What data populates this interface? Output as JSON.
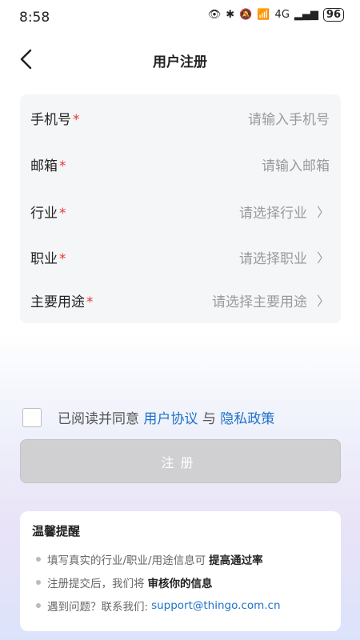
{
  "status": {
    "time": "8:58",
    "battery": "96",
    "network": "4G"
  },
  "nav": {
    "title": "用户注册"
  },
  "form": [
    {
      "label": "手机号",
      "placeholder": "请输入手机号",
      "chevron": false
    },
    {
      "label": "邮箱",
      "placeholder": "请输入邮箱",
      "chevron": false
    },
    {
      "label": "行业",
      "placeholder": "请选择行业",
      "chevron": true
    },
    {
      "label": "职业",
      "placeholder": "请选择职业",
      "chevron": true
    },
    {
      "label": "主要用途",
      "placeholder": "请选择主要用途",
      "chevron": true
    }
  ],
  "agreement": {
    "prefix": "已阅读并同意",
    "terms": "用户协议",
    "and": "与",
    "privacy": "隐私政策"
  },
  "submit_label": "注册",
  "tips": {
    "title": "温馨提醒",
    "items": [
      {
        "text": "填写真实的行业/职业/用途信息可",
        "strong": "提高通过率"
      },
      {
        "text": "注册提交后，我们将",
        "strong": "审核你的信息"
      },
      {
        "text": "遇到问题？联系我们:",
        "email": "support@thingo.com.cn"
      }
    ]
  },
  "colors": {
    "accent": "#1e72c8",
    "required": "#e53935",
    "button_disabled": "#d0d0d3"
  }
}
